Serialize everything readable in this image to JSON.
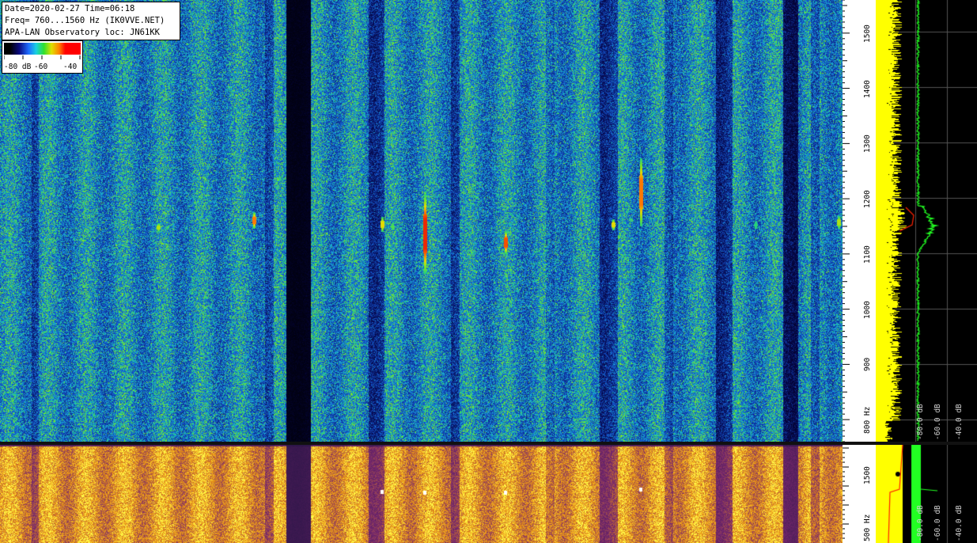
{
  "info": {
    "line1": "Date=2020-02-27 Time=06:18",
    "line2": "Freq= 760...1560 Hz (IK0VVE.NET)",
    "line3": "APA-LAN Observatory loc: JN61KK"
  },
  "legend": {
    "label_80": "-80 dB",
    "label_60": "-60",
    "label_40": "-40"
  },
  "axis_top": {
    "ticks": [
      "1500",
      "1400",
      "1300",
      "1200",
      "1100",
      "1000",
      "900",
      "800 Hz"
    ],
    "range_hz": [
      760,
      1560
    ]
  },
  "axis_bottom": {
    "ticks": [
      "1500",
      "500 Hz"
    ]
  },
  "spectrum_db_labels": {
    "top": [
      "-80.0 dB",
      "-60.0 dB",
      "-40.0 dB"
    ],
    "bottom": [
      "-80.0 dB",
      "-60.0 dB",
      "-40.0 dB"
    ]
  },
  "colors": {
    "spectrum_avg": "#ffff00",
    "spectrum_peak": "#22ff22",
    "spectrum_marker": "#ff2200",
    "grid": "#555555"
  }
}
